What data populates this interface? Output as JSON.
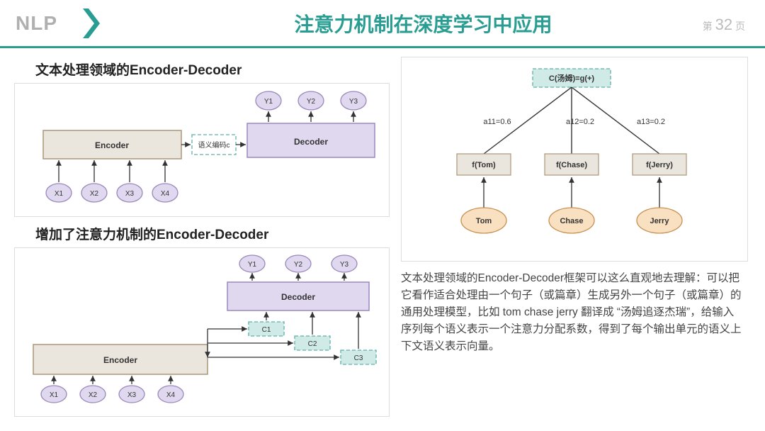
{
  "header": {
    "logo": "NLP",
    "title": "注意力机制在深度学习中应用",
    "page_prefix": "第",
    "page_num": "32",
    "page_suffix": "页"
  },
  "left": {
    "section1_title": "文本处理领域的Encoder-Decoder",
    "section2_title": "增加了注意力机制的Encoder-Decoder",
    "diag1": {
      "encoder": "Encoder",
      "decoder": "Decoder",
      "semantic": "语义编码c",
      "x": [
        "X1",
        "X2",
        "X3",
        "X4"
      ],
      "y": [
        "Y1",
        "Y2",
        "Y3"
      ]
    },
    "diag2": {
      "encoder": "Encoder",
      "decoder": "Decoder",
      "c": [
        "C1",
        "C2",
        "C3"
      ],
      "x": [
        "X1",
        "X2",
        "X3",
        "X4"
      ],
      "y": [
        "Y1",
        "Y2",
        "Y3"
      ]
    }
  },
  "right": {
    "att": {
      "top": "C(汤姆)=g(+)",
      "weights": [
        "a11=0.6",
        "a12=0.2",
        "a13=0.2"
      ],
      "fnodes": [
        "f(Tom)",
        "f(Chase)",
        "f(Jerry)"
      ],
      "words": [
        "Tom",
        "Chase",
        "Jerry"
      ]
    },
    "paragraph": "文本处理领域的Encoder-Decoder框架可以这么直观地去理解：可以把它看作适合处理由一个句子（或篇章）生成另外一个句子（或篇章）的通用处理模型，比如 tom chase jerry 翻译成 “汤姆追逐杰瑞”，给输入序列每个语义表示一个注意力分配系数，得到了每个输出单元的语义上下文语义表示向量。"
  }
}
